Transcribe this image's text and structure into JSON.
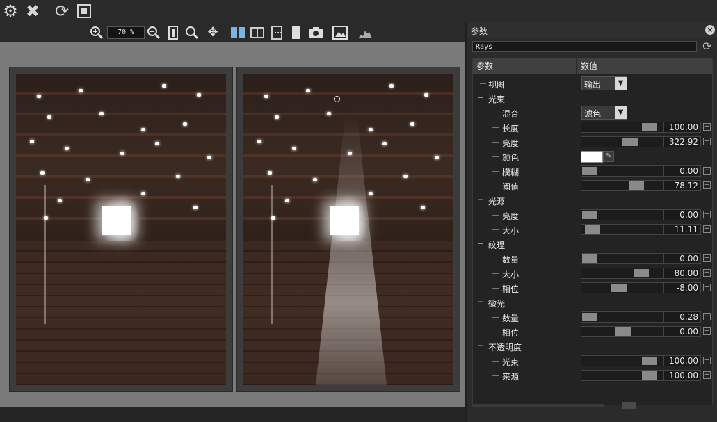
{
  "toolbar": {
    "icons": [
      "gear-icon",
      "close-icon",
      "refresh-icon",
      "crop-icon"
    ]
  },
  "view_toolbar": {
    "zoom_value": "70 %",
    "icons": [
      "zoom-in-icon",
      "zoom-out-icon",
      "fit-icon",
      "zoom-icon",
      "pan-icon",
      "split-view-icon",
      "side-by-side-icon",
      "split-horizontal-icon",
      "single-view-icon",
      "snapshot-icon",
      "image-icon",
      "histogram-icon"
    ]
  },
  "panel": {
    "title": "参数",
    "preset": "Rays",
    "columns": {
      "param": "参数",
      "value": "数值"
    },
    "rows": [
      {
        "kind": "dropdown",
        "label": "视图",
        "value": "输出",
        "level": 1
      },
      {
        "kind": "group",
        "label": "光束"
      },
      {
        "kind": "dropdown",
        "label": "混合",
        "value": "滤色",
        "level": 2
      },
      {
        "kind": "slider",
        "label": "长度",
        "value": "100.00",
        "pos": 0.9,
        "level": 2
      },
      {
        "kind": "slider",
        "label": "亮度",
        "value": "322.92",
        "pos": 0.61,
        "level": 2
      },
      {
        "kind": "color",
        "label": "颜色",
        "color": "#ffffff",
        "level": 2
      },
      {
        "kind": "slider",
        "label": "模糊",
        "value": "0.00",
        "pos": 0.0,
        "level": 2
      },
      {
        "kind": "slider",
        "label": "阈值",
        "value": "78.12",
        "pos": 0.7,
        "level": 2
      },
      {
        "kind": "group",
        "label": "光源"
      },
      {
        "kind": "slider",
        "label": "亮度",
        "value": "0.00",
        "pos": 0.0,
        "level": 2
      },
      {
        "kind": "slider",
        "label": "大小",
        "value": "11.11",
        "pos": 0.04,
        "level": 2
      },
      {
        "kind": "group",
        "label": "纹理"
      },
      {
        "kind": "slider",
        "label": "数量",
        "value": "0.00",
        "pos": 0.0,
        "level": 2
      },
      {
        "kind": "slider",
        "label": "大小",
        "value": "80.00",
        "pos": 0.78,
        "level": 2
      },
      {
        "kind": "slider",
        "label": "相位",
        "value": "-8.00",
        "pos": 0.44,
        "level": 2
      },
      {
        "kind": "group",
        "label": "微光"
      },
      {
        "kind": "slider",
        "label": "数量",
        "value": "0.28",
        "pos": 0.0,
        "level": 2
      },
      {
        "kind": "slider",
        "label": "相位",
        "value": "0.00",
        "pos": 0.5,
        "level": 2
      },
      {
        "kind": "group",
        "label": "不透明度"
      },
      {
        "kind": "slider",
        "label": "光束",
        "value": "100.00",
        "pos": 0.9,
        "level": 2
      },
      {
        "kind": "slider",
        "label": "来源",
        "value": "100.00",
        "pos": 0.9,
        "level": 2
      }
    ]
  }
}
